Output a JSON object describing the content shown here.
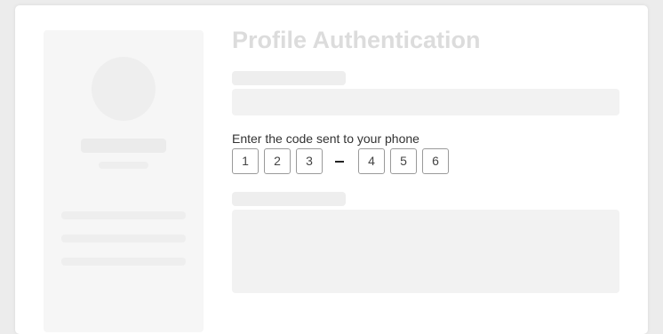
{
  "header": {
    "title": "Profile Authentication"
  },
  "verification": {
    "prompt": "Enter the code sent to your phone",
    "digits": [
      "1",
      "2",
      "3",
      "4",
      "5",
      "6"
    ]
  },
  "colors": {
    "background": "#ececec",
    "card": "#ffffff",
    "skeleton": "#eeeeee",
    "title": "#dcdcdc",
    "digit_border": "#9a9a9a"
  }
}
